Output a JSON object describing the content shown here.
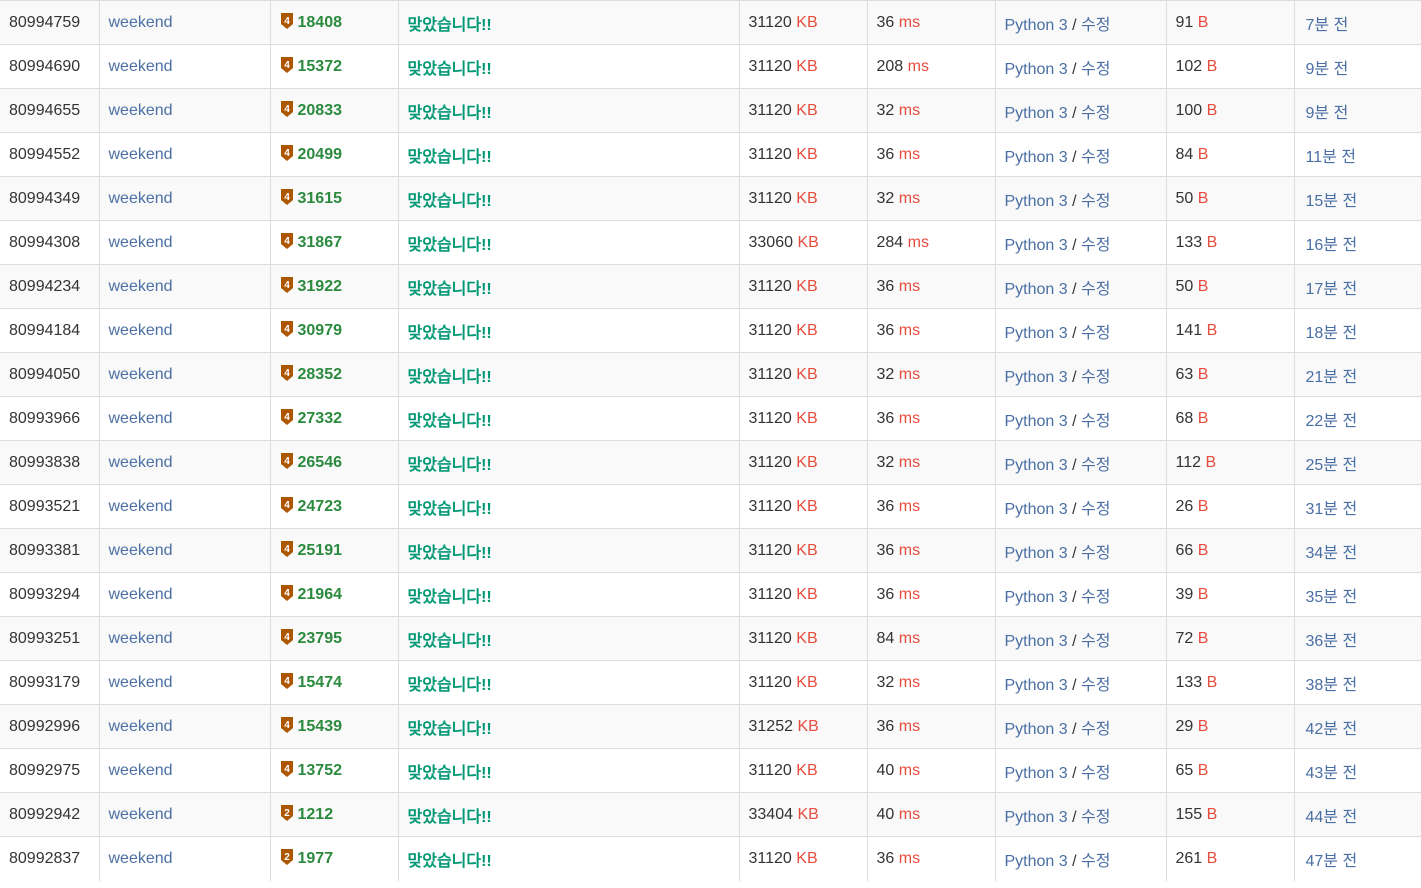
{
  "colors": {
    "tier_bronze": "#ad5600",
    "accent_green": "#009874",
    "unit_red": "#e74c3c",
    "link_blue": "#4a6fa5"
  },
  "rows": [
    {
      "id": "80994759",
      "user": "weekend",
      "tier": "4",
      "problem": "18408",
      "result": "맞았습니다!!",
      "memory": "31120",
      "memory_unit": "KB",
      "time": "36",
      "time_unit": "ms",
      "lang": "Python 3",
      "sep": "/",
      "edit": "수정",
      "length": "91",
      "length_unit": "B",
      "submitted": "7분 전"
    },
    {
      "id": "80994690",
      "user": "weekend",
      "tier": "4",
      "problem": "15372",
      "result": "맞았습니다!!",
      "memory": "31120",
      "memory_unit": "KB",
      "time": "208",
      "time_unit": "ms",
      "lang": "Python 3",
      "sep": "/",
      "edit": "수정",
      "length": "102",
      "length_unit": "B",
      "submitted": "9분 전"
    },
    {
      "id": "80994655",
      "user": "weekend",
      "tier": "4",
      "problem": "20833",
      "result": "맞았습니다!!",
      "memory": "31120",
      "memory_unit": "KB",
      "time": "32",
      "time_unit": "ms",
      "lang": "Python 3",
      "sep": "/",
      "edit": "수정",
      "length": "100",
      "length_unit": "B",
      "submitted": "9분 전"
    },
    {
      "id": "80994552",
      "user": "weekend",
      "tier": "4",
      "problem": "20499",
      "result": "맞았습니다!!",
      "memory": "31120",
      "memory_unit": "KB",
      "time": "36",
      "time_unit": "ms",
      "lang": "Python 3",
      "sep": "/",
      "edit": "수정",
      "length": "84",
      "length_unit": "B",
      "submitted": "11분 전"
    },
    {
      "id": "80994349",
      "user": "weekend",
      "tier": "4",
      "problem": "31615",
      "result": "맞았습니다!!",
      "memory": "31120",
      "memory_unit": "KB",
      "time": "32",
      "time_unit": "ms",
      "lang": "Python 3",
      "sep": "/",
      "edit": "수정",
      "length": "50",
      "length_unit": "B",
      "submitted": "15분 전"
    },
    {
      "id": "80994308",
      "user": "weekend",
      "tier": "4",
      "problem": "31867",
      "result": "맞았습니다!!",
      "memory": "33060",
      "memory_unit": "KB",
      "time": "284",
      "time_unit": "ms",
      "lang": "Python 3",
      "sep": "/",
      "edit": "수정",
      "length": "133",
      "length_unit": "B",
      "submitted": "16분 전"
    },
    {
      "id": "80994234",
      "user": "weekend",
      "tier": "4",
      "problem": "31922",
      "result": "맞았습니다!!",
      "memory": "31120",
      "memory_unit": "KB",
      "time": "36",
      "time_unit": "ms",
      "lang": "Python 3",
      "sep": "/",
      "edit": "수정",
      "length": "50",
      "length_unit": "B",
      "submitted": "17분 전"
    },
    {
      "id": "80994184",
      "user": "weekend",
      "tier": "4",
      "problem": "30979",
      "result": "맞았습니다!!",
      "memory": "31120",
      "memory_unit": "KB",
      "time": "36",
      "time_unit": "ms",
      "lang": "Python 3",
      "sep": "/",
      "edit": "수정",
      "length": "141",
      "length_unit": "B",
      "submitted": "18분 전"
    },
    {
      "id": "80994050",
      "user": "weekend",
      "tier": "4",
      "problem": "28352",
      "result": "맞았습니다!!",
      "memory": "31120",
      "memory_unit": "KB",
      "time": "32",
      "time_unit": "ms",
      "lang": "Python 3",
      "sep": "/",
      "edit": "수정",
      "length": "63",
      "length_unit": "B",
      "submitted": "21분 전"
    },
    {
      "id": "80993966",
      "user": "weekend",
      "tier": "4",
      "problem": "27332",
      "result": "맞았습니다!!",
      "memory": "31120",
      "memory_unit": "KB",
      "time": "36",
      "time_unit": "ms",
      "lang": "Python 3",
      "sep": "/",
      "edit": "수정",
      "length": "68",
      "length_unit": "B",
      "submitted": "22분 전"
    },
    {
      "id": "80993838",
      "user": "weekend",
      "tier": "4",
      "problem": "26546",
      "result": "맞았습니다!!",
      "memory": "31120",
      "memory_unit": "KB",
      "time": "32",
      "time_unit": "ms",
      "lang": "Python 3",
      "sep": "/",
      "edit": "수정",
      "length": "112",
      "length_unit": "B",
      "submitted": "25분 전"
    },
    {
      "id": "80993521",
      "user": "weekend",
      "tier": "4",
      "problem": "24723",
      "result": "맞았습니다!!",
      "memory": "31120",
      "memory_unit": "KB",
      "time": "36",
      "time_unit": "ms",
      "lang": "Python 3",
      "sep": "/",
      "edit": "수정",
      "length": "26",
      "length_unit": "B",
      "submitted": "31분 전"
    },
    {
      "id": "80993381",
      "user": "weekend",
      "tier": "4",
      "problem": "25191",
      "result": "맞았습니다!!",
      "memory": "31120",
      "memory_unit": "KB",
      "time": "36",
      "time_unit": "ms",
      "lang": "Python 3",
      "sep": "/",
      "edit": "수정",
      "length": "66",
      "length_unit": "B",
      "submitted": "34분 전"
    },
    {
      "id": "80993294",
      "user": "weekend",
      "tier": "4",
      "problem": "21964",
      "result": "맞았습니다!!",
      "memory": "31120",
      "memory_unit": "KB",
      "time": "36",
      "time_unit": "ms",
      "lang": "Python 3",
      "sep": "/",
      "edit": "수정",
      "length": "39",
      "length_unit": "B",
      "submitted": "35분 전"
    },
    {
      "id": "80993251",
      "user": "weekend",
      "tier": "4",
      "problem": "23795",
      "result": "맞았습니다!!",
      "memory": "31120",
      "memory_unit": "KB",
      "time": "84",
      "time_unit": "ms",
      "lang": "Python 3",
      "sep": "/",
      "edit": "수정",
      "length": "72",
      "length_unit": "B",
      "submitted": "36분 전"
    },
    {
      "id": "80993179",
      "user": "weekend",
      "tier": "4",
      "problem": "15474",
      "result": "맞았습니다!!",
      "memory": "31120",
      "memory_unit": "KB",
      "time": "32",
      "time_unit": "ms",
      "lang": "Python 3",
      "sep": "/",
      "edit": "수정",
      "length": "133",
      "length_unit": "B",
      "submitted": "38분 전"
    },
    {
      "id": "80992996",
      "user": "weekend",
      "tier": "4",
      "problem": "15439",
      "result": "맞았습니다!!",
      "memory": "31252",
      "memory_unit": "KB",
      "time": "36",
      "time_unit": "ms",
      "lang": "Python 3",
      "sep": "/",
      "edit": "수정",
      "length": "29",
      "length_unit": "B",
      "submitted": "42분 전"
    },
    {
      "id": "80992975",
      "user": "weekend",
      "tier": "4",
      "problem": "13752",
      "result": "맞았습니다!!",
      "memory": "31120",
      "memory_unit": "KB",
      "time": "40",
      "time_unit": "ms",
      "lang": "Python 3",
      "sep": "/",
      "edit": "수정",
      "length": "65",
      "length_unit": "B",
      "submitted": "43분 전"
    },
    {
      "id": "80992942",
      "user": "weekend",
      "tier": "2",
      "problem": "1212",
      "result": "맞았습니다!!",
      "memory": "33404",
      "memory_unit": "KB",
      "time": "40",
      "time_unit": "ms",
      "lang": "Python 3",
      "sep": "/",
      "edit": "수정",
      "length": "155",
      "length_unit": "B",
      "submitted": "44분 전"
    },
    {
      "id": "80992837",
      "user": "weekend",
      "tier": "2",
      "problem": "1977",
      "result": "맞았습니다!!",
      "memory": "31120",
      "memory_unit": "KB",
      "time": "36",
      "time_unit": "ms",
      "lang": "Python 3",
      "sep": "/",
      "edit": "수정",
      "length": "261",
      "length_unit": "B",
      "submitted": "47분 전"
    }
  ]
}
